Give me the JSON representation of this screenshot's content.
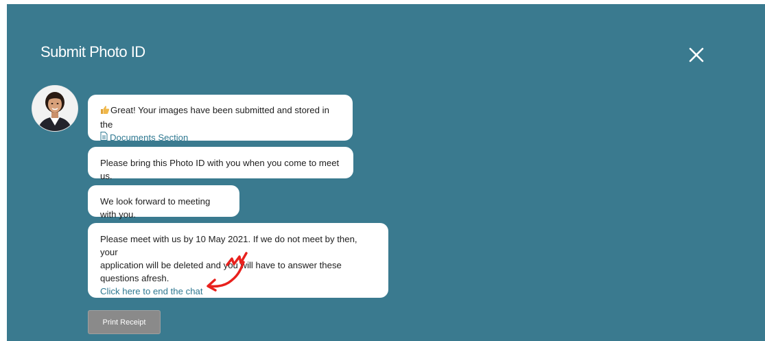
{
  "dialog": {
    "title": "Submit Photo ID",
    "close_icon": "close-icon",
    "background_color": "#3a7a8f"
  },
  "agent": {
    "avatar": "agent-avatar"
  },
  "messages": [
    {
      "icon": "thumbs-up-icon",
      "text": "Great! Your images have been submitted and stored in the",
      "link_icon": "document-icon",
      "link_label": "Documents Section"
    },
    {
      "text": "Please bring this Photo ID with you when you come to meet us."
    },
    {
      "text": "We look forward to meeting with you."
    },
    {
      "text_line1": "Please meet with us by 10 May 2021. If we do not meet by then, your",
      "text_line2": "application will be deleted and you will have to answer these",
      "text_line3": "questions afresh.",
      "link_label": "Click here to end the chat"
    }
  ],
  "actions": {
    "print_label": "Print Receipt"
  },
  "colors": {
    "link": "#2e7891",
    "annotation": "#e8211d"
  }
}
